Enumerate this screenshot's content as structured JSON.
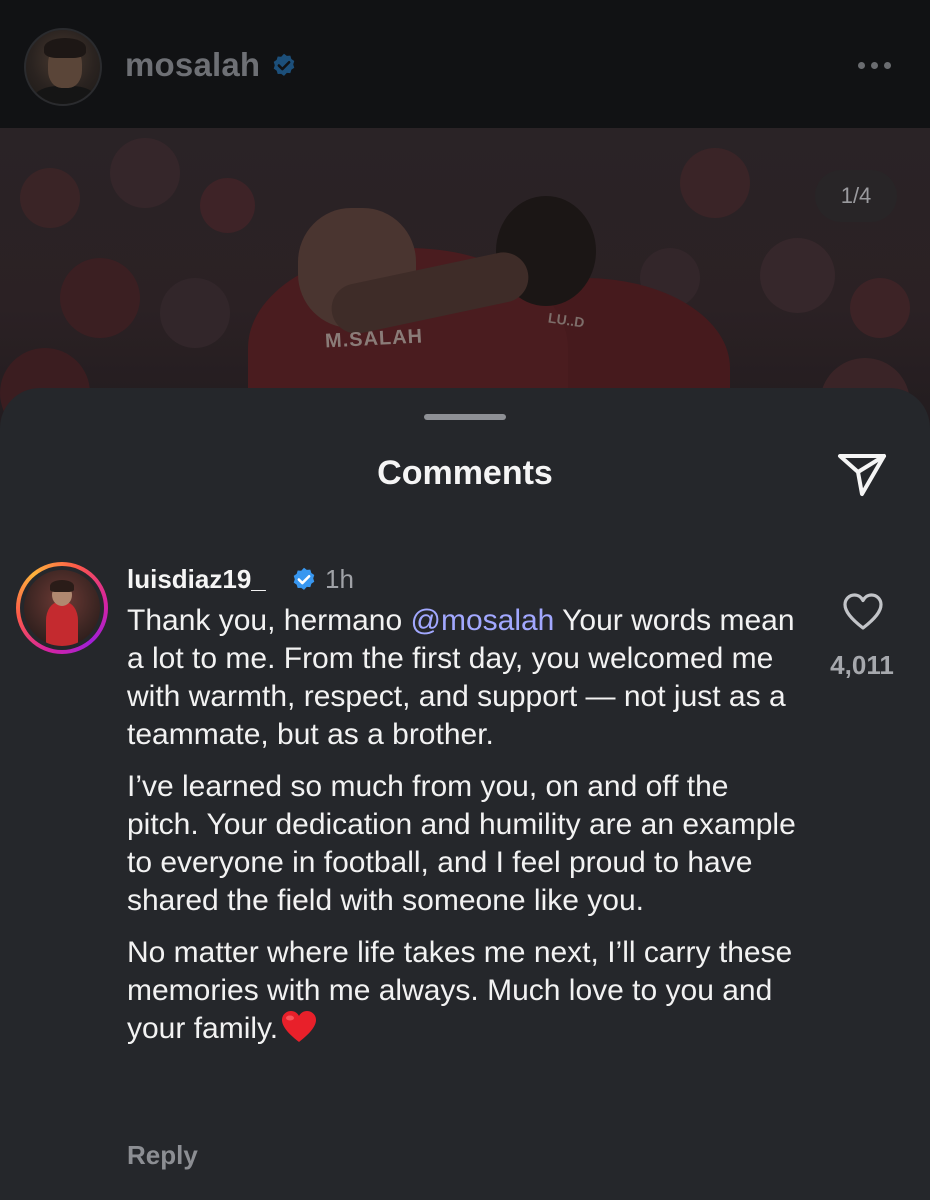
{
  "header": {
    "username": "mosalah",
    "verified_icon": "verified-badge-icon",
    "more_icon": "more-horizontal-icon"
  },
  "post": {
    "image_counter": "1/4",
    "jersey_name": "M.SALAH",
    "jersey_name_2": "LU..D"
  },
  "sheet": {
    "title": "Comments",
    "share_icon": "send-icon"
  },
  "comment": {
    "username": "luisdiaz19_",
    "time": "1h",
    "mention": "@mosalah",
    "line1_before": "Thank you, hermano ",
    "line1_after": " Your words mean a lot to me. From the first day, you welcomed me with warmth, respect, and support — not just as a teammate, but as a brother.",
    "paragraph2": "I’ve learned so much from you, on and off the pitch. Your dedication and humility are an example to everyone in football, and I feel proud to have shared the field with someone like you.",
    "paragraph3": "No matter where life takes me next, I’ll carry these memories with me always. Much love to you and your family.",
    "emoji": "red-heart-emoji",
    "like_count": "4,011",
    "reply_label": "Reply"
  },
  "colors": {
    "sheet_bg": "#25272b",
    "mention": "#a2a8ff",
    "verified": "#3897f0",
    "muted_text": "#a0a2a7"
  }
}
